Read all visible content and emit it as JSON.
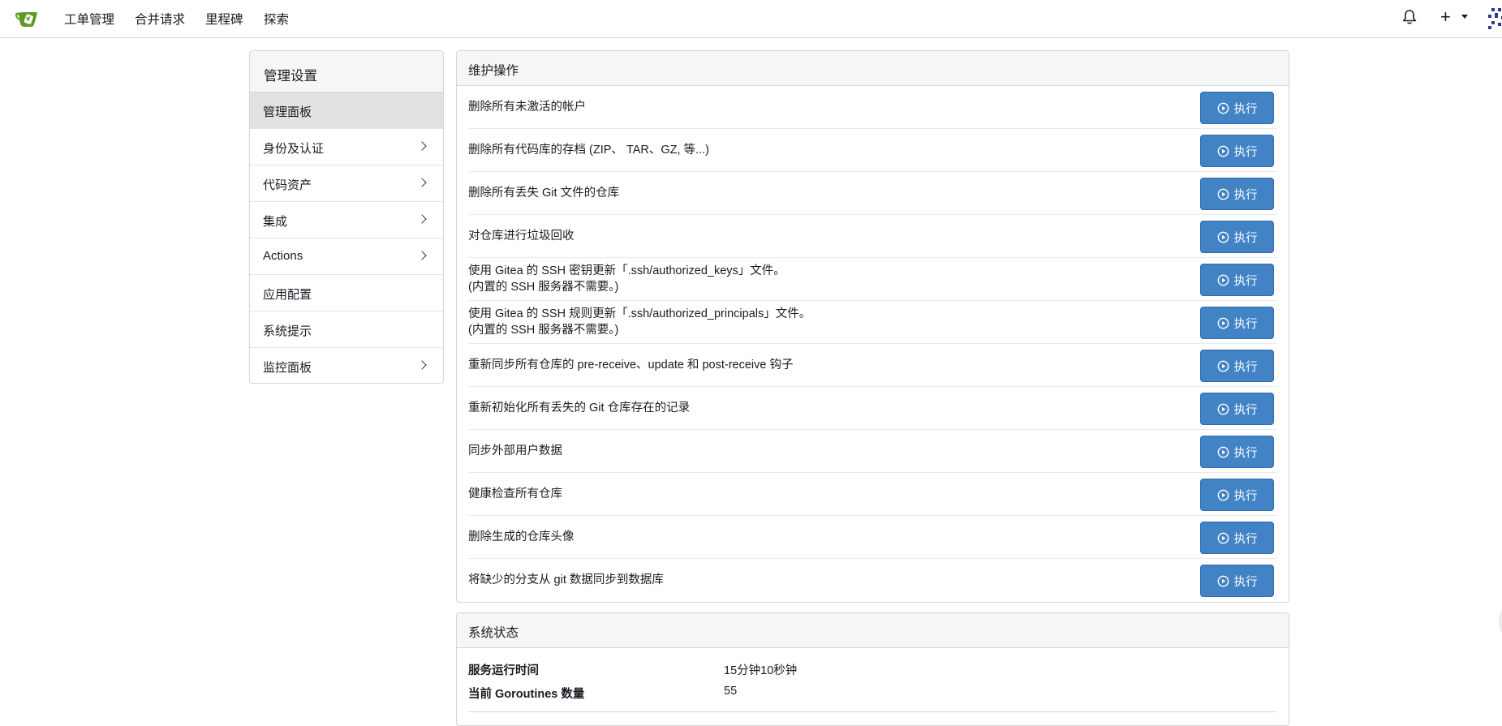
{
  "nav": {
    "items": [
      {
        "id": "issues",
        "label": "工单管理"
      },
      {
        "id": "pulls",
        "label": "合并请求"
      },
      {
        "id": "milestones",
        "label": "里程碑"
      },
      {
        "id": "explore",
        "label": "探索"
      }
    ],
    "plus_label": "+"
  },
  "sidebar": {
    "title": "管理设置",
    "items": [
      {
        "label": "管理面板",
        "active": true,
        "has_children": false
      },
      {
        "label": "身份及认证",
        "active": false,
        "has_children": true
      },
      {
        "label": "代码资产",
        "active": false,
        "has_children": true
      },
      {
        "label": "集成",
        "active": false,
        "has_children": true
      },
      {
        "label": "Actions",
        "active": false,
        "has_children": true
      },
      {
        "label": "应用配置",
        "active": false,
        "has_children": false
      },
      {
        "label": "系统提示",
        "active": false,
        "has_children": false
      },
      {
        "label": "监控面板",
        "active": false,
        "has_children": true
      }
    ]
  },
  "maintenance": {
    "title": "维护操作",
    "run_label": "执行",
    "operations": [
      {
        "lines": [
          "删除所有未激活的帐户"
        ]
      },
      {
        "lines": [
          "删除所有代码库的存档 (ZIP、 TAR、GZ, 等...)"
        ]
      },
      {
        "lines": [
          "删除所有丢失 Git 文件的仓库"
        ]
      },
      {
        "lines": [
          "对仓库进行垃圾回收"
        ]
      },
      {
        "lines": [
          "使用 Gitea 的 SSH 密钥更新「.ssh/authorized_keys」文件。",
          "(内置的 SSH 服务器不需要。)"
        ]
      },
      {
        "lines": [
          "使用 Gitea 的 SSH 规则更新「.ssh/authorized_principals」文件。",
          "(内置的 SSH 服务器不需要。)"
        ]
      },
      {
        "lines": [
          "重新同步所有仓库的 pre-receive、update 和 post-receive 钩子"
        ]
      },
      {
        "lines": [
          "重新初始化所有丢失的 Git 仓库存在的记录"
        ]
      },
      {
        "lines": [
          "同步外部用户数据"
        ]
      },
      {
        "lines": [
          "健康检查所有仓库"
        ]
      },
      {
        "lines": [
          "删除生成的仓库头像"
        ]
      },
      {
        "lines": [
          "将缺少的分支从 git 数据同步到数据库"
        ]
      }
    ]
  },
  "system_status": {
    "title": "系统状态",
    "rows": [
      {
        "key": "服务运行时间",
        "value": "15分钟10秒钟"
      },
      {
        "key": "当前 Goroutines 数量",
        "value": "55"
      }
    ]
  },
  "colors": {
    "primary": "#4183c4",
    "logo_green": "#609926",
    "border": "#d0d7de",
    "active_bg": "#e2e2e2"
  },
  "icons": {
    "logo": "gitea-logo-icon",
    "notifications": "bell-icon",
    "create": "plus-icon",
    "run": "play-circle-icon"
  }
}
